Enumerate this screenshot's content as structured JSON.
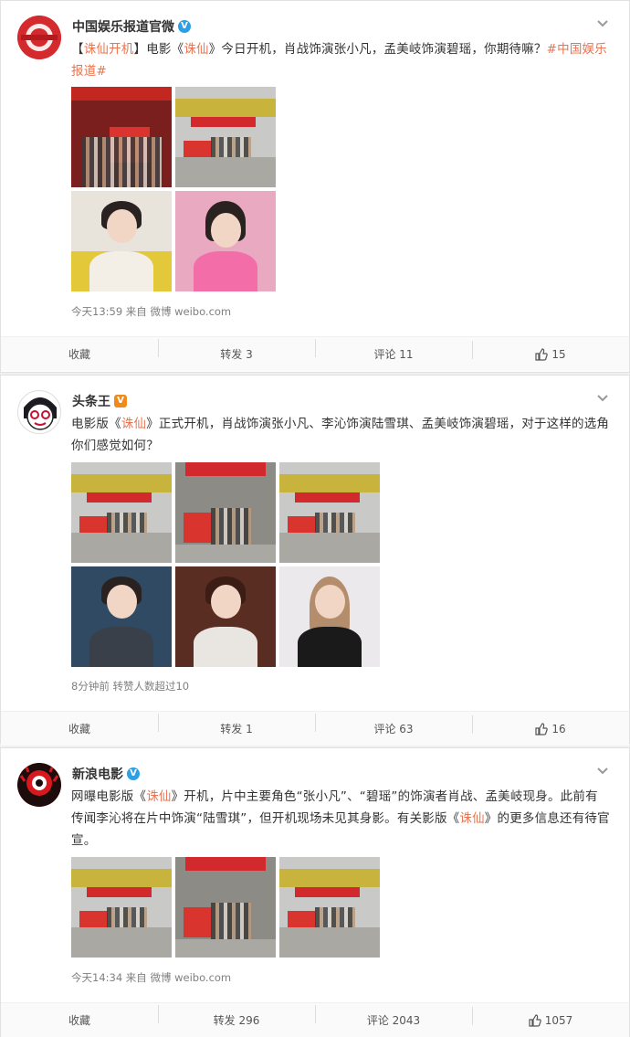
{
  "posts": [
    {
      "user": "中国娱乐报道官微",
      "badge": "V",
      "text_parts": [
        "【",
        "诛仙开机",
        "】电影《",
        "诛仙",
        "》今日开机，肖战饰演张小凡，孟美岐饰演碧瑶，你期待嘛？",
        "#中国娱乐报道#"
      ],
      "meta": "今天13:59 来自 微博 weibo.com",
      "actions": {
        "fav": "收藏",
        "repost": "转发 3",
        "comment": "评论 11",
        "like": "15"
      }
    },
    {
      "user": "头条王",
      "badge": "V",
      "text_parts": [
        "电影版《",
        "诛仙",
        "》正式开机，肖战饰演张小凡、李沁饰演陆雪琪、孟美岐饰演碧瑶，对于这样的选角你们感觉如何？"
      ],
      "meta": "8分钟前 转赞人数超过10",
      "actions": {
        "fav": "收藏",
        "repost": "转发 1",
        "comment": "评论 63",
        "like": "16"
      }
    },
    {
      "user": "新浪电影",
      "badge": "V",
      "text_parts": [
        "网曝电影版《",
        "诛仙",
        "》开机，片中主要角色“张小凡”、“碧瑶”的饰演者肖战、孟美岐现身。此前有传闻李沁将在片中饰演“陆雪琪”，但开机现场未见其身影。有关影版《",
        "诛仙",
        "》的更多信息还有待官宣。"
      ],
      "meta": "今天14:34 来自 微博 weibo.com",
      "actions": {
        "fav": "收藏",
        "repost": "转发 296",
        "comment": "评论 2043",
        "like": "1057"
      }
    }
  ],
  "icons": {
    "more": "chevron-down-icon",
    "like": "thumbs-up-icon",
    "verified": "verified-badge-icon"
  },
  "colors": {
    "link": "#eb7350",
    "verified_blue": "#2aa0e8",
    "verified_orange": "#f08a18"
  }
}
